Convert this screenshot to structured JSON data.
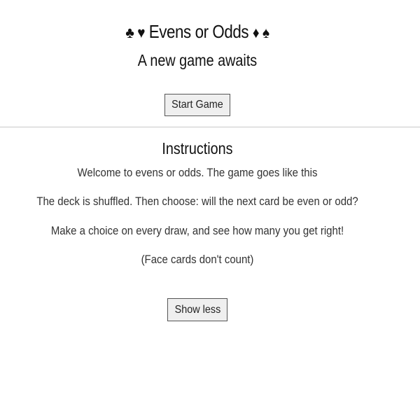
{
  "header": {
    "suits_left": "♣ ♥",
    "title": "Evens or Odds",
    "suits_right": "♦ ♠",
    "subtitle": "A new game awaits"
  },
  "controls": {
    "start_label": "Start Game",
    "toggle_label": "Show less"
  },
  "instructions": {
    "heading": "Instructions",
    "lines": [
      "Welcome to evens or odds. The game goes like this",
      "The deck is shuffled. Then choose: will the next card be even or odd?",
      "Make a choice on every draw, and see how many you get right!",
      "(Face cards don't count)"
    ]
  }
}
